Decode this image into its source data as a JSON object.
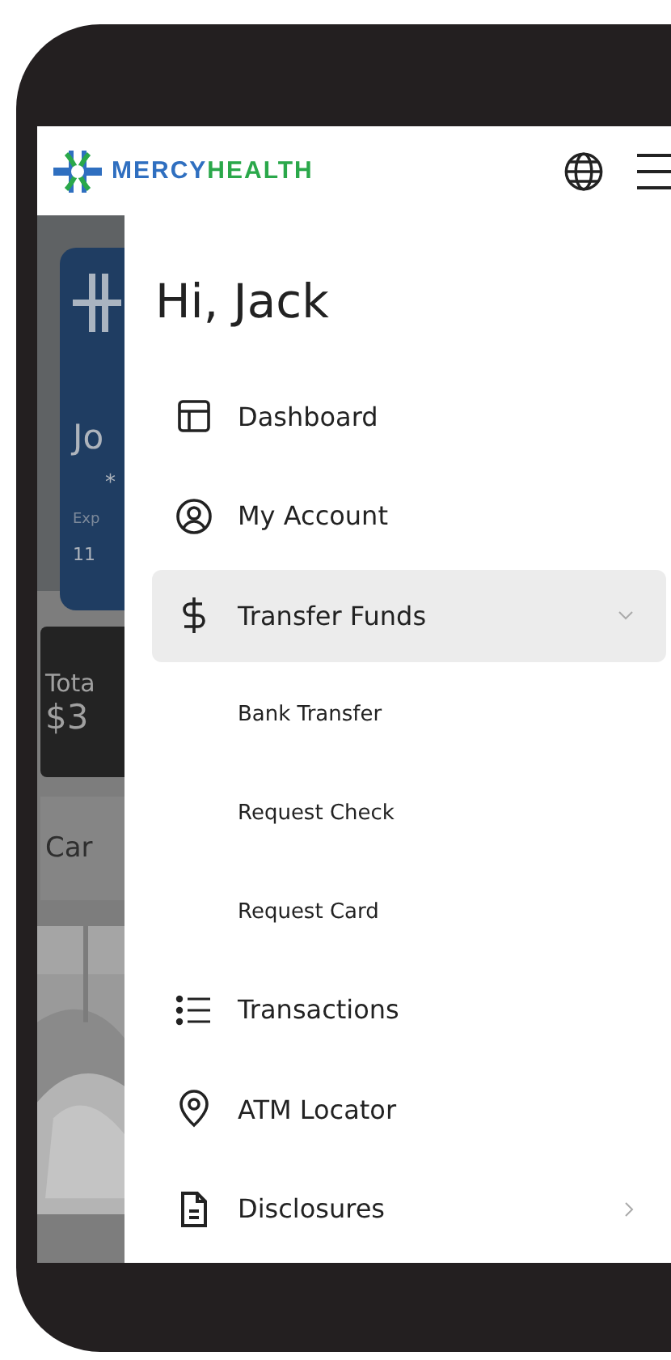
{
  "header": {
    "logo": {
      "part_1": "MERCY",
      "part_2": "HEALTH"
    }
  },
  "background": {
    "card_name": "Jo",
    "card_number": "*",
    "card_label": "Exp",
    "card_date": "11",
    "total_label": "Tota",
    "total_value": "$3",
    "cards_label": "Car"
  },
  "drawer": {
    "greeting": "Hi, Jack",
    "items": [
      {
        "kind": "item",
        "label": "Dashboard",
        "selected": false
      },
      {
        "kind": "item",
        "label": "My Account",
        "selected": false
      },
      {
        "kind": "item",
        "label": "Transfer Funds",
        "selected": true,
        "expanded": true
      },
      {
        "kind": "subitem",
        "label": "Bank Transfer",
        "selected": false
      },
      {
        "kind": "subitem",
        "label": "Request Check",
        "selected": false
      },
      {
        "kind": "subitem",
        "label": "Request Card",
        "selected": false
      },
      {
        "kind": "item",
        "label": "Transactions",
        "selected": false
      },
      {
        "kind": "item",
        "label": "ATM Locator",
        "selected": false
      },
      {
        "kind": "item",
        "label": "Disclosures",
        "selected": false,
        "expanded": false
      }
    ]
  }
}
